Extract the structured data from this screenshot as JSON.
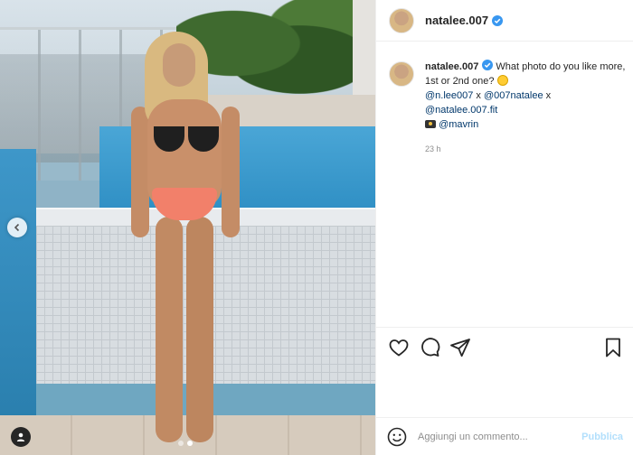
{
  "post": {
    "username": "natalee.007",
    "caption": {
      "username": "natalee.007",
      "text_line1": " What photo do you like more, 1st or 2nd one? ",
      "mention_1": "@n.lee007",
      "sep_1": " x ",
      "mention_2": "@007natalee",
      "sep_2": " x",
      "mention_3": "@natalee.007.fit",
      "mention_4": "@mavrin"
    },
    "timestamp": "23 h"
  },
  "carousel": {
    "current_index": 1,
    "total": 2
  },
  "comment_box": {
    "placeholder": "Aggiungi un commento...",
    "publish_label": "Pubblica"
  },
  "colors": {
    "verified": "#3897f0",
    "mention": "#00376b",
    "publish_disabled": "#b2dffc",
    "muted": "#8e8e8e"
  },
  "icons": [
    "chevron-left-icon",
    "user-tag-icon",
    "verified-badge-icon",
    "heart-icon",
    "comment-icon",
    "share-icon",
    "bookmark-icon",
    "emoji-icon",
    "camera-emoji-icon"
  ]
}
